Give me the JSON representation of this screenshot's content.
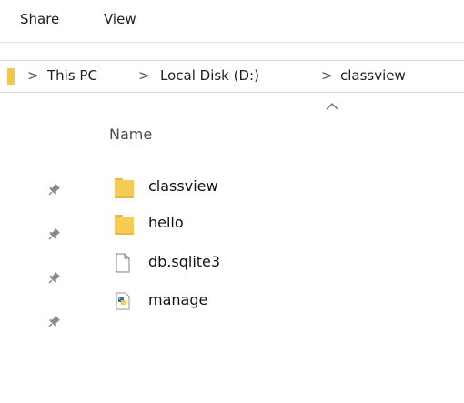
{
  "ribbon": {
    "tabs": [
      "Share",
      "View"
    ]
  },
  "address_bar": {
    "crumbs": [
      "This PC",
      "Local Disk (D:)",
      "classview"
    ],
    "separator": ">"
  },
  "content": {
    "column_header": "Name",
    "sort_indicator": "ascending",
    "files": [
      {
        "name": "classview",
        "type": "folder",
        "icon": "folder-icon"
      },
      {
        "name": "hello",
        "type": "folder",
        "icon": "folder-icon"
      },
      {
        "name": "db.sqlite3",
        "type": "file",
        "icon": "blank-file-icon"
      },
      {
        "name": "manage",
        "type": "python",
        "icon": "python-file-icon"
      }
    ]
  },
  "nav_pane": {
    "pinned_icon": "pin-icon",
    "pinned_count": 4
  },
  "colors": {
    "folder": "#f6cc57",
    "text": "#1e1e1e",
    "divider": "#e3e3e3"
  }
}
